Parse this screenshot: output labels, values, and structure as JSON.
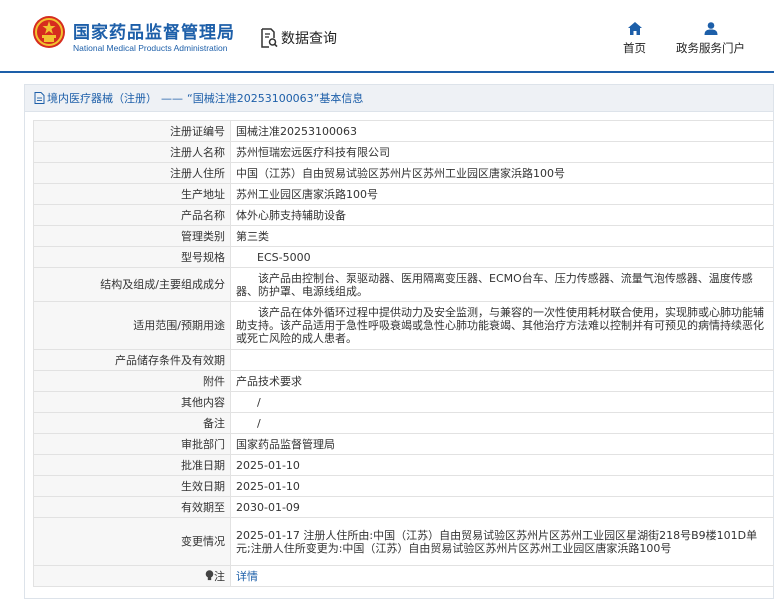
{
  "header": {
    "brand_cn": "国家药品监督管理局",
    "brand_en": "National Medical Products Administration",
    "query_label": "数据查询",
    "nav": [
      {
        "label": "首页",
        "icon": "home-icon"
      },
      {
        "label": "政务服务门户",
        "icon": "user-icon"
      }
    ]
  },
  "breadcrumb": {
    "section": "境内医疗器械（注册）",
    "separator": "——",
    "detail": "“国械注准20253100063”基本信息"
  },
  "fields": [
    {
      "label": "注册证编号",
      "value": "国械注准20253100063"
    },
    {
      "label": "注册人名称",
      "value": "苏州恒瑞宏远医疗科技有限公司"
    },
    {
      "label": "注册人住所",
      "value": "中国（江苏）自由贸易试验区苏州片区苏州工业园区唐家浜路100号"
    },
    {
      "label": "生产地址",
      "value": "苏州工业园区唐家浜路100号"
    },
    {
      "label": "产品名称",
      "value": "体外心肺支持辅助设备"
    },
    {
      "label": "管理类别",
      "value": "第三类"
    },
    {
      "label": "型号规格",
      "value": "ECS-5000"
    },
    {
      "label": "结构及组成/主要组成成分",
      "value": "该产品由控制台、泵驱动器、医用隔离变压器、ECMO台车、压力传感器、流量气泡传感器、温度传感器、防护罩、电源线组成。"
    },
    {
      "label": "适用范围/预期用途",
      "value": "该产品在体外循环过程中提供动力及安全监测，与兼容的一次性使用耗材联合使用，实现肺或心肺功能辅助支持。该产品适用于急性呼吸衰竭或急性心肺功能衰竭、其他治疗方法难以控制并有可预见的病情持续恶化或死亡风险的成人患者。"
    },
    {
      "label": "产品储存条件及有效期",
      "value": ""
    },
    {
      "label": "附件",
      "value": "产品技术要求"
    },
    {
      "label": "其他内容",
      "value": "/"
    },
    {
      "label": "备注",
      "value": "/"
    },
    {
      "label": "审批部门",
      "value": "国家药品监督管理局"
    },
    {
      "label": "批准日期",
      "value": "2025-01-10"
    },
    {
      "label": "生效日期",
      "value": "2025-01-10"
    },
    {
      "label": "有效期至",
      "value": "2030-01-09"
    },
    {
      "label": "变更情况",
      "value": "2025-01-17 注册人住所由:中国（江苏）自由贸易试验区苏州片区苏州工业园区星湖街218号B9楼101D单元;注册人住所变更为:中国（江苏）自由贸易试验区苏州片区苏州工业园区唐家浜路100号"
    },
    {
      "label": "注",
      "value": "详情"
    }
  ]
}
